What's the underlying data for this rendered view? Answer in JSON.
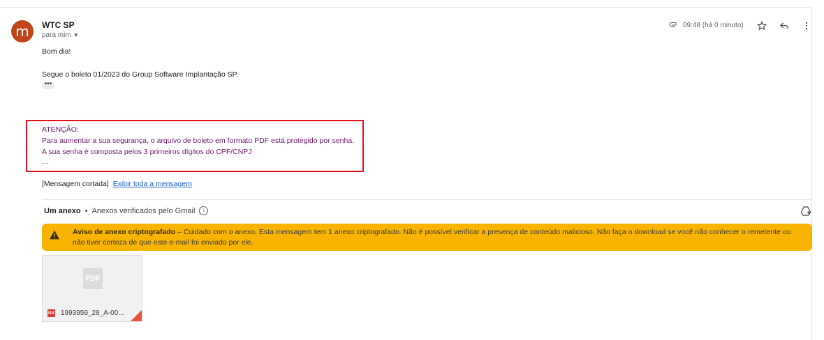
{
  "sender": {
    "avatar_letter": "m",
    "name": "WTC SP",
    "recipient": "para mim"
  },
  "meta": {
    "time": "09:48 (há 0 minuto)"
  },
  "body": {
    "greeting": "Bom dia!",
    "line1": "Segue o boleto 01/2023 do Group Software Implantação SP.",
    "more_dots": "•••",
    "attention": "ATENÇÃO:",
    "line2": "Para aumentar a sua segurança, o arquivo de boleto em formato PDF está protegido por senha.",
    "line3": "A sua senha é composta pelos 3 primeiros dígitos do CPF/CNPJ",
    "ellipsis": "..."
  },
  "trimmed": {
    "label": "[Mensagem cortada]",
    "link": "Exibir toda a mensagem"
  },
  "attachments": {
    "count_label": "Um anexo",
    "separator": "•",
    "verified": "Anexos verificados pelo Gmail",
    "info": "i"
  },
  "warning": {
    "title": "Aviso de anexo criptografado",
    "text": " – Cuidado com o anexo. Esta mensagem tem 1 anexo criptografado. Não é possível verificar a presença de conteúdo malicioso. Não faça o download se você não conhecer o remetente ou não tiver certeza de que este e-mail foi enviado por ele."
  },
  "file": {
    "thumb_label": "PDF",
    "badge": "PDF",
    "name": "1993959_28_A-00..."
  },
  "colors": {
    "avatar": "#c1451c",
    "warning": "#f8b400",
    "highlight_box": "#e3121b",
    "purple_text": "#6b1a6b",
    "link": "#1a5dc4"
  },
  "icons": [
    "paperclip-icon",
    "star-icon",
    "reply-icon",
    "more-vert-icon",
    "add-to-drive-icon",
    "warning-icon",
    "info-icon",
    "pdf-icon"
  ]
}
